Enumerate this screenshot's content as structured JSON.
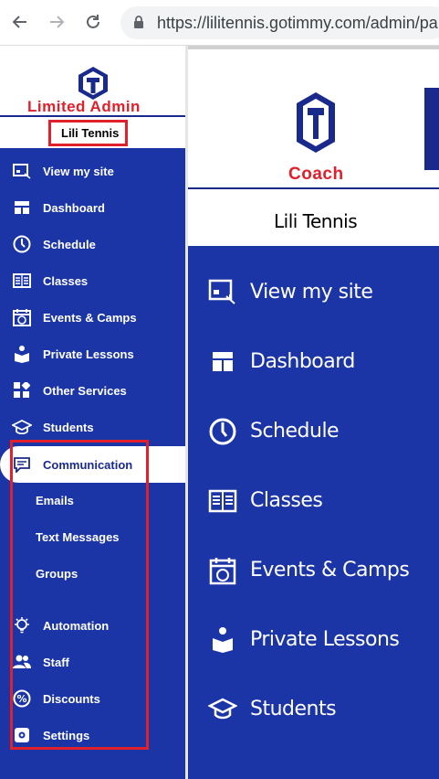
{
  "browser": {
    "url": "https://lilitennis.gotimmy.com/admin/pa"
  },
  "left_panel": {
    "role_label": "Limited Admin",
    "account_name": "Lili Tennis",
    "nav": {
      "view_site": "View my site",
      "dashboard": "Dashboard",
      "schedule": "Schedule",
      "classes": "Classes",
      "events": "Events & Camps",
      "private_lessons": "Private Lessons",
      "other_services": "Other Services",
      "students": "Students",
      "communication": "Communication",
      "emails": "Emails",
      "text_messages": "Text Messages",
      "groups": "Groups",
      "automation": "Automation",
      "staff": "Staff",
      "discounts": "Discounts",
      "settings": "Settings"
    }
  },
  "right_panel": {
    "role_label": "Coach",
    "account_name": "Lili Tennis",
    "nav": {
      "view_site": "View my site",
      "dashboard": "Dashboard",
      "schedule": "Schedule",
      "classes": "Classes",
      "events": "Events & Camps",
      "private_lessons": "Private Lessons",
      "students": "Students"
    }
  },
  "colors": {
    "nav_blue": "#1c35a6",
    "logo_navy": "#1a2a8c",
    "highlight_red": "#e0202b"
  },
  "icons": [
    "back-arrow-icon",
    "forward-arrow-icon",
    "reload-icon",
    "lock-icon",
    "site-icon",
    "dashboard-icon",
    "clock-icon",
    "book-icon",
    "calendar-clock-icon",
    "person-lesson-icon",
    "grid-icon",
    "graduation-cap-icon",
    "chat-icon",
    "bulb-icon",
    "people-icon",
    "percent-icon",
    "gear-icon"
  ]
}
